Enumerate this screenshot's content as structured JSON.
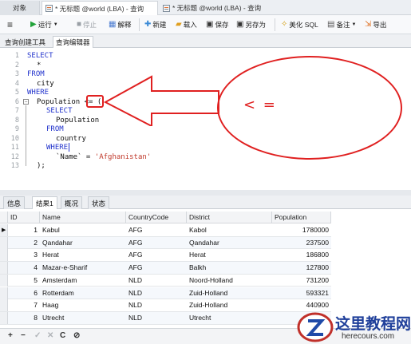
{
  "tabs": [
    {
      "label": "对象"
    },
    {
      "label": "* 无标题 @world (LBA) - 查询"
    },
    {
      "label": "* 无标题 @world (LBA) - 查询"
    }
  ],
  "toolbar": {
    "menu_icon": "menu-icon",
    "run": "运行",
    "stop": "停止",
    "explain": "解释",
    "new": "新建",
    "load": "载入",
    "save": "保存",
    "save_as": "另存为",
    "beautify": "美化 SQL",
    "backup": "备注",
    "export": "导出"
  },
  "subtabs": [
    "查询创建工具",
    "查询编辑器"
  ],
  "editor": {
    "line_numbers": [
      "1",
      "2",
      "3",
      "4",
      "5",
      "6",
      "7",
      "8",
      "9",
      "10",
      "11",
      "12",
      "13"
    ],
    "lines": {
      "l1": "SELECT",
      "l2": "*",
      "l3": "FROM",
      "l4": "city",
      "l5": "WHERE",
      "l6a": "Population ",
      "l6b": "<=",
      "l6c": " (",
      "l7": "SELECT",
      "l8": "Population",
      "l9": "FROM",
      "l10": "country",
      "l11": "WHERE",
      "l12a": "`Name` = ",
      "l12b": "'Afghanistan'",
      "l13": ");"
    }
  },
  "annotation": {
    "text": "< =",
    "color": "#e02020"
  },
  "result_tabs": [
    "信息",
    "结果1",
    "概况",
    "状态"
  ],
  "grid": {
    "columns": [
      "ID",
      "Name",
      "CountryCode",
      "District",
      "Population"
    ],
    "rows": [
      {
        "id": "1",
        "name": "Kabul",
        "code": "AFG",
        "district": "Kabol",
        "pop": "1780000"
      },
      {
        "id": "2",
        "name": "Qandahar",
        "code": "AFG",
        "district": "Qandahar",
        "pop": "237500"
      },
      {
        "id": "3",
        "name": "Herat",
        "code": "AFG",
        "district": "Herat",
        "pop": "186800"
      },
      {
        "id": "4",
        "name": "Mazar-e-Sharif",
        "code": "AFG",
        "district": "Balkh",
        "pop": "127800"
      },
      {
        "id": "5",
        "name": "Amsterdam",
        "code": "NLD",
        "district": "Noord-Holland",
        "pop": "731200"
      },
      {
        "id": "6",
        "name": "Rotterdam",
        "code": "NLD",
        "district": "Zuid-Holland",
        "pop": "593321"
      },
      {
        "id": "7",
        "name": "Haag",
        "code": "NLD",
        "district": "Zuid-Holland",
        "pop": "440900"
      },
      {
        "id": "8",
        "name": "Utrecht",
        "code": "NLD",
        "district": "Utrecht",
        "pop": ""
      }
    ]
  },
  "statusbar": {
    "add": "+",
    "remove": "−",
    "confirm": "✓",
    "discard": "✕",
    "refresh": "C",
    "stop": "⊘"
  },
  "watermark": {
    "title": "这里教程网",
    "url": "herecours.com"
  }
}
